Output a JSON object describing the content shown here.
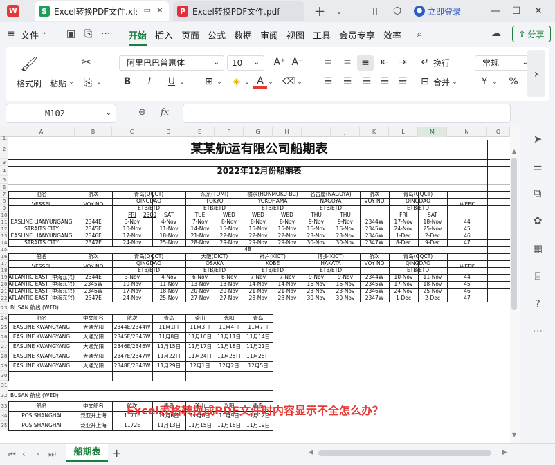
{
  "titlebar": {
    "tabs": [
      {
        "label": "Excel转换PDF文件.xlsx",
        "icon": "S",
        "color": "#1e9e5a",
        "active": true
      },
      {
        "label": "Excel转换PDF文件.pdf",
        "icon": "P",
        "color": "#e0303c",
        "active": false
      }
    ],
    "login_label": "立即登录"
  },
  "menubar": {
    "file_label": "文件",
    "items": [
      "开始",
      "插入",
      "页面",
      "公式",
      "数据",
      "审阅",
      "视图",
      "工具",
      "会员专享",
      "效率"
    ],
    "share_label": "分享"
  },
  "ribbon": {
    "format_painter": "格式刷",
    "paste": "粘贴",
    "font_name": "阿里巴巴普惠体",
    "font_size": "10",
    "wrap": "换行",
    "merge": "合并",
    "number_format": "常规"
  },
  "formula_bar": {
    "cell_ref": "M102",
    "fx": "fx"
  },
  "columns": [
    "A",
    "B",
    "C",
    "D",
    "E",
    "F",
    "G",
    "H",
    "I",
    "J",
    "K",
    "L",
    "M",
    "N",
    "O"
  ],
  "sheet": {
    "title": "某某航运有限公司船期表",
    "subtitle": "2022年12月份船期表",
    "header1": {
      "ship": "船名",
      "voyage": "航次",
      "vessel": "VESSEL",
      "voy": "VOY NO",
      "qingdao_cn": "青岛(QQCT)",
      "qingdao": "QINGDAO",
      "tokyo_cn": "东京(TOMI)",
      "tokyo": "TOKYO",
      "yoko_cn": "横滨(HONMOKU-BC)",
      "yoko": "YOKOHAMA",
      "nagoya_cn": "名古屋(NAGOYA)",
      "nagoya": "NAGOYA",
      "voyage2": "航次",
      "qingdao2_cn": "青岛(QQCT)",
      "qingdao2": "QINGDAO",
      "week": "WEEK",
      "etb": "ETB/ETD",
      "days": [
        "FRI",
        "2300",
        "SAT",
        "TUE",
        "WED",
        "WED",
        "WED",
        "THU",
        "THU",
        "FRI",
        "SAT"
      ]
    },
    "block1": [
      [
        "EASLINE LIANYUNGANG",
        "2344E",
        "3-Nov",
        "4-Nov",
        "7-Nov",
        "8-Nov",
        "8-Nov",
        "8-Nov",
        "9-Nov",
        "9-Nov",
        "2344W",
        "17-Nov",
        "18-Nov",
        "44"
      ],
      [
        "STRAITS CITY",
        "2345E",
        "10-Nov",
        "11-Nov",
        "14-Nov",
        "15-Nov",
        "15-Nov",
        "15-Nov",
        "16-Nov",
        "16-Nov",
        "2345W",
        "24-Nov",
        "25-Nov",
        "45"
      ],
      [
        "EASLINE LIANYUNGANG",
        "2346E",
        "17-Nov",
        "18-Nov",
        "21-Nov",
        "22-Nov",
        "22-Nov",
        "22-Nov",
        "23-Nov",
        "23-Nov",
        "2346W",
        "1-Dec",
        "2-Dec",
        "46"
      ],
      [
        "STRAITS CITY",
        "2347E",
        "24-Nov",
        "25-Nov",
        "28-Nov",
        "29-Nov",
        "29-Nov",
        "29-Nov",
        "30-Nov",
        "30-Nov",
        "2347W",
        "8-Dec",
        "9-Dec",
        "47"
      ]
    ],
    "row15_week": "48",
    "header2": {
      "osaka_cn": "大阪(DICT)",
      "osaka": "OSAKA",
      "kobe_cn": "神户(KICT)",
      "kobe": "KOBE",
      "hakata_cn": "博多(KICT)",
      "hakata": "HAKATA"
    },
    "block2": [
      [
        "ATLANTIC EAST (中海东兴)",
        "2344E",
        "3-Nov",
        "4-Nov",
        "6-Nov",
        "6-Nov",
        "7-Nov",
        "7-Nov",
        "9-Nov",
        "9-Nov",
        "2344W",
        "10-Nov",
        "11-Nov",
        "44"
      ],
      [
        "ATLANTIC EAST (中海东兴)",
        "2345W",
        "10-Nov",
        "11-Nov",
        "13-Nov",
        "13-Nov",
        "14-Nov",
        "14-Nov",
        "16-Nov",
        "16-Nov",
        "2345W",
        "17-Nov",
        "18-Nov",
        "45"
      ],
      [
        "ATLANTIC EAST (中海东兴)",
        "2346W",
        "17-Nov",
        "18-Nov",
        "20-Nov",
        "20-Nov",
        "21-Nov",
        "21-Nov",
        "23-Nov",
        "23-Nov",
        "2346W",
        "24-Nov",
        "25-Nov",
        "46"
      ],
      [
        "ATLANTIC EAST (中海东兴)",
        "2347E",
        "24-Nov",
        "25-Nov",
        "27-Nov",
        "27-Nov",
        "28-Nov",
        "28-Nov",
        "30-Nov",
        "30-Nov",
        "2347W",
        "1-Dec",
        "2-Dec",
        "47"
      ]
    ],
    "busan1": {
      "title": "BUSAN 航线 (WED)",
      "headers": [
        "船名",
        "中文船名",
        "航次",
        "青岛",
        "釜山",
        "光阳",
        "青岛"
      ],
      "rows": [
        [
          "EASLINE KWANGYANG",
          "大通光阳",
          "2344E/2344W",
          "11月1日",
          "11月3日",
          "11月4日",
          "11月7日"
        ],
        [
          "EASLINE KWANGYANG",
          "大通光阳",
          "2345E/2345W",
          "11月8日",
          "11月10日",
          "11月11日",
          "11月14日"
        ],
        [
          "EASLINE KWANGYANG",
          "大通光阳",
          "2346E/2346W",
          "11月15日",
          "11月17日",
          "11月18日",
          "11月21日"
        ],
        [
          "EASLINE KWANGYANG",
          "大通光阳",
          "2347E/2347W",
          "11月22日",
          "11月24日",
          "11月25日",
          "11月28日"
        ],
        [
          "EASLINE KWANGYANG",
          "大通光阳",
          "2348E/2348W",
          "11月29日",
          "12月1日",
          "12月2日",
          "12月5日"
        ]
      ]
    },
    "busan2": {
      "title": "BUSAN 航线 (WED)",
      "headers": [
        "船名",
        "中文船名",
        "航次",
        "青岛",
        "釜山",
        "光阳",
        "青岛"
      ],
      "rows": [
        [
          "POS SHANGHAI",
          "泛亚升上海",
          "1171E",
          "11月6日",
          "11月8日",
          "11月9日",
          "11月12日"
        ],
        [
          "POS SHANGHAI",
          "泛亚升上海",
          "1172E",
          "11月13日",
          "11月15日",
          "11月16日",
          "11月19日"
        ]
      ]
    },
    "overlay_text": "Excel表格转换成PDF文件时内容显示不全怎么办？"
  },
  "bottombar": {
    "sheet_tab": "船期表",
    "add": "+"
  }
}
